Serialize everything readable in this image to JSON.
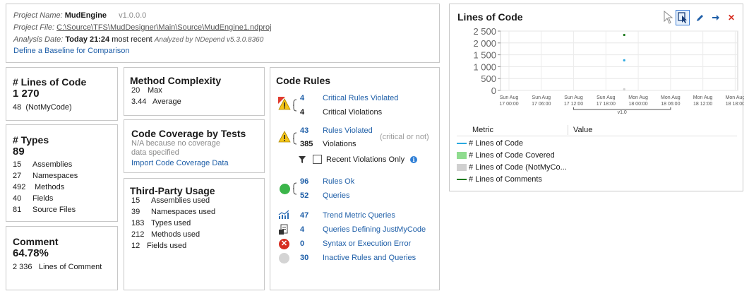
{
  "project": {
    "name_label": "Project Name:",
    "name": "MudEngine",
    "version": "v1.0.0.0",
    "file_label": "Project File:",
    "file": "C:\\Source\\TFS\\MudDesigner\\Main\\Source\\MudEngine1.ndproj",
    "date_label": "Analysis Date:",
    "date": "Today 21:24",
    "date_note": "most recent",
    "analyzed_by": "Analyzed by NDepend v5.3.0.8360",
    "baseline_link": "Define a Baseline for Comparison"
  },
  "loc": {
    "title": "# Lines of Code",
    "value": "1 270",
    "notmycode_num": "48",
    "notmycode_label": "(NotMyCode)"
  },
  "types": {
    "title": "# Types",
    "value": "89",
    "rows": [
      {
        "n": "15",
        "label": "Assemblies"
      },
      {
        "n": "27",
        "label": "Namespaces"
      },
      {
        "n": "492",
        "label": "Methods"
      },
      {
        "n": "40",
        "label": "Fields"
      },
      {
        "n": "81",
        "label": "Source Files"
      }
    ]
  },
  "comment": {
    "title": "Comment",
    "value": "64.78%",
    "num": "2 336",
    "label": "Lines of Comment"
  },
  "complexity": {
    "title": "Method Complexity",
    "max_num": "20",
    "max_label": "Max",
    "avg_num": "3.44",
    "avg_label": "Average"
  },
  "coverage": {
    "title": "Code Coverage by Tests",
    "note1": "N/A because no coverage",
    "note2": "data specified",
    "import_link": "Import Code Coverage Data"
  },
  "thirdparty": {
    "title": "Third-Party Usage",
    "rows": [
      {
        "n": "15",
        "label": "Assemblies used"
      },
      {
        "n": "39",
        "label": "Namespaces used"
      },
      {
        "n": "183",
        "label": "Types used"
      },
      {
        "n": "212",
        "label": "Methods used"
      },
      {
        "n": "12",
        "label": "Fields used"
      }
    ]
  },
  "rules": {
    "title": "Code Rules",
    "critical_num": "4",
    "critical_label": "Critical Rules Violated",
    "critical_viol_num": "4",
    "critical_viol_label": "Critical Violations",
    "violated_num": "43",
    "violated_label": "Rules Violated",
    "violated_note": "(critical or not)",
    "viol_num": "385",
    "viol_label": "Violations",
    "recent_label": "Recent Violations Only",
    "ok_num": "96",
    "ok_label": "Rules Ok",
    "queries_num": "52",
    "queries_label": "Queries",
    "trend_num": "47",
    "trend_label": "Trend Metric Queries",
    "jmc_num": "4",
    "jmc_label": "Queries Defining JustMyCode",
    "err_num": "0",
    "err_label": "Syntax or Execution Error",
    "inactive_num": "30",
    "inactive_label": "Inactive Rules and Queries"
  },
  "chart_panel": {
    "title": "Lines of Code",
    "metric_header": "Metric",
    "value_header": "Value",
    "legend": [
      {
        "label": "# Lines of Code",
        "color": "#29a8e0"
      },
      {
        "label": "# Lines of Code Covered",
        "color": "#8fdc8f"
      },
      {
        "label": "# Lines of Code (NotMyCo...",
        "color": "#d0d0d0"
      },
      {
        "label": "# Lines of Comments",
        "color": "#1e7a1e"
      }
    ]
  },
  "chart_data": {
    "type": "scatter",
    "yticks": [
      "2 500",
      "2 000",
      "1 500",
      "1 000",
      "500",
      "0"
    ],
    "ylim": [
      0,
      2500
    ],
    "xticks": [
      [
        "Sun Aug",
        "17 00:00"
      ],
      [
        "Sun Aug",
        "17 06:00"
      ],
      [
        "Sun Aug",
        "17 12:00"
      ],
      [
        "Sun Aug",
        "17 18:00"
      ],
      [
        "Mon Aug",
        "18 00:00"
      ],
      [
        "Mon Aug",
        "18 06:00"
      ],
      [
        "Mon Aug",
        "18 12:00"
      ],
      [
        "Mon Aug",
        "18 18:00"
      ]
    ],
    "annotation": "v1.0",
    "grid": true,
    "series": [
      {
        "name": "# Lines of Code",
        "x": "Sun Aug 17 21:24",
        "value": 1270,
        "color": "#29a8e0"
      },
      {
        "name": "# Lines of Comments",
        "x": "Sun Aug 17 21:24",
        "value": 2336,
        "color": "#1e7a1e"
      },
      {
        "name": "# Lines of Code (NotMyCode)",
        "x": "Sun Aug 17 21:24",
        "value": 48,
        "color": "#d0d0d0"
      }
    ]
  }
}
